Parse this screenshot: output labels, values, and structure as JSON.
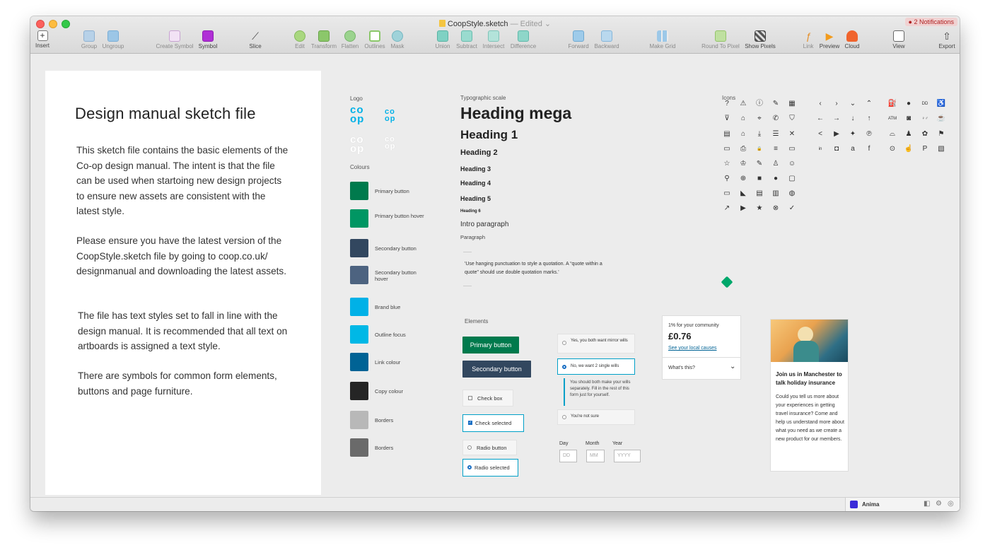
{
  "window": {
    "file_name": "CoopStyle.sketch",
    "edited": "— Edited",
    "notifications": "● 2 Notifications"
  },
  "toolbar": {
    "insert": "Insert",
    "group": "Group",
    "ungroup": "Ungroup",
    "create_symbol": "Create Symbol",
    "symbol": "Symbol",
    "slice": "Slice",
    "edit": "Edit",
    "transform": "Transform",
    "flatten": "Flatten",
    "outlines": "Outlines",
    "mask": "Mask",
    "union": "Union",
    "subtract": "Subtract",
    "intersect": "Intersect",
    "difference": "Difference",
    "forward": "Forward",
    "backward": "Backward",
    "make_grid": "Make Grid",
    "round_to_pixel": "Round To Pixel",
    "show_pixels": "Show Pixels",
    "link": "Link",
    "preview": "Preview",
    "cloud": "Cloud",
    "view": "View",
    "export": "Export"
  },
  "artboard": {
    "title": "Design manual sketch file",
    "p1": "This sketch file contains the basic elements of the Co-op design manual. The intent is that the file can be used when startoing new design projects to ensure new assets are consistent with the latest style.",
    "p2": "Please ensure you have the latest version of the CoopStyle.sketch file by going to coop.co.uk/ designmanual and downloading the latest assets.",
    "p3": "The file has text styles set to fall in line with the design manual. It is recommended that all text on artboards is assigned a text style.",
    "p4": "There are symbols for common form elements, buttons and page furniture."
  },
  "logo": {
    "label": "Logo",
    "mark": "co\nop"
  },
  "colours": {
    "label": "Colours",
    "items": [
      {
        "name": "Primary button",
        "color": "#007a4d"
      },
      {
        "name": "Primary button hover",
        "color": "#009663"
      },
      {
        "name": "Secondary button",
        "color": "#32475f"
      },
      {
        "name": "Secondary button hover",
        "color": "#4d6380"
      },
      {
        "name": "Brand blue",
        "color": "#00b1e7"
      },
      {
        "name": "Outline focus",
        "color": "#00b8e6"
      },
      {
        "name": "Link colour",
        "color": "#006395"
      },
      {
        "name": "Copy colour",
        "color": "#252525"
      },
      {
        "name": "Borders",
        "color": "#b8b8b8"
      },
      {
        "name": "Borders",
        "color": "#6a6a6a"
      }
    ]
  },
  "typography": {
    "label": "Typographic scale",
    "heading_mega": "Heading mega",
    "h1": "Heading 1",
    "h2": "Heading 2",
    "h3": "Heading 3",
    "h4": "Heading 4",
    "h5": "Heading 5",
    "h6": "Heading 6",
    "intro": "Intro paragraph",
    "paragraph": "Paragraph",
    "quote": "'Use hanging punctuation to style a quotation. A “quote within a quote” should use double quotation marks.'"
  },
  "icons": {
    "label": "Icons"
  },
  "elements": {
    "label": "Elements",
    "primary_button": "Primary button",
    "secondary_button": "Secondary  button",
    "check_box": "Check box",
    "check_selected": "Check selected",
    "radio_button": "Radio button",
    "radio_selected": "Radio selected",
    "radio_opt1": "Yes, you both want mirror wills",
    "radio_opt2": "No, we want 2 single wills",
    "radio_hint": "You should both make your wills separately. Fill in the rest of this form just for yourself.",
    "radio_opt3": "You're not sure",
    "day_label": "Day",
    "month_label": "Month",
    "year_label": "Year",
    "day_ph": "DD",
    "month_ph": "MM",
    "year_ph": "YYYY"
  },
  "community_card": {
    "caption": "1% for your community",
    "amount": "£0.76",
    "link": "See your local causes",
    "toggle": "What's this?"
  },
  "promo_card": {
    "title": "Join us in Manchester to talk holiday insurance",
    "body": "Could you tell us more about your experiences in getting travel insurance? Come and help us understand more about what you need as we create a new product for our members."
  },
  "status": {
    "plugin": "Anima"
  }
}
